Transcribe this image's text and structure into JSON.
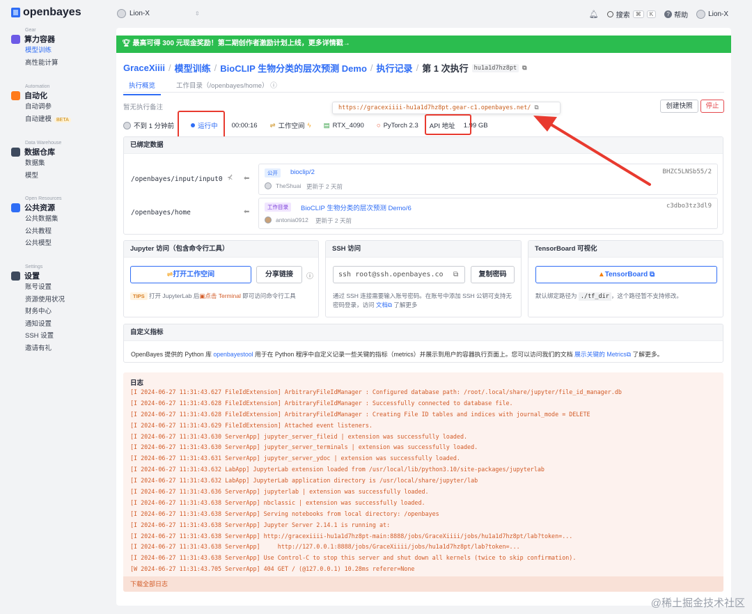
{
  "brand": "openbayes",
  "sidebar": [
    {
      "eng": "Gear",
      "title": "算力容器",
      "color": "#6d5ae6",
      "items": [
        {
          "label": "模型训练",
          "active": true
        },
        {
          "label": "高性能计算"
        }
      ]
    },
    {
      "eng": "Automation",
      "title": "自动化",
      "color": "#ff7a1a",
      "items": [
        {
          "label": "自动调参"
        },
        {
          "label": "自动建模",
          "badge": "BETA"
        }
      ]
    },
    {
      "eng": "Data Warehouse",
      "title": "数据仓库",
      "color": "#3e4a5e",
      "items": [
        {
          "label": "数据集"
        },
        {
          "label": "模型"
        }
      ]
    },
    {
      "eng": "Open Resources",
      "title": "公共资源",
      "color": "#2f6df5",
      "items": [
        {
          "label": "公共数据集"
        },
        {
          "label": "公共教程"
        },
        {
          "label": "公共模型"
        }
      ]
    },
    {
      "eng": "Settings",
      "title": "设置",
      "color": "#3e4a5e",
      "items": [
        {
          "label": "账号设置"
        },
        {
          "label": "资源使用状况"
        },
        {
          "label": "财务中心"
        },
        {
          "label": "通知设置"
        },
        {
          "label": "SSH 设置"
        },
        {
          "label": "邀请有礼"
        }
      ]
    }
  ],
  "topbar": {
    "workspace": "Lion-X",
    "search": "搜索",
    "kbd1": "⌘",
    "kbd2": "K",
    "help": "帮助",
    "user": "Lion-X"
  },
  "banner": "最高可得 300 元现金奖励！第二期创作者激励计划上线，更多详情戳→",
  "breadcrumb": {
    "c1": "GraceXiiii",
    "c2": "模型训练",
    "c3": "BioCLIP 生物分类的层次预测 Demo",
    "c4": "执行记录",
    "c5": "第 1 次执行",
    "hash": "hu1a1d7hz8pt"
  },
  "tabs": {
    "t1": "执行概览",
    "t2": "工作目录（/openbayes/home）"
  },
  "note": "暂无执行备注",
  "buttons": {
    "snapshot": "创建快照",
    "stop": "停止"
  },
  "tooltip": "https://gracexiiii-hu1a1d7hz8pt.gear-c1.openbayes.net/",
  "status": {
    "time": "不到 1 分钟前",
    "state": "运行中",
    "duration": "00:00:16",
    "workspace": "工作空间",
    "gpu": "RTX_4090",
    "framework": "PyTorch 2.3",
    "api": "API 地址",
    "size": "1.99 GB"
  },
  "bound": {
    "title": "已绑定数据",
    "row1": {
      "path": "/openbayes/input/input0",
      "tag": "公开",
      "name": "bioclip/2",
      "user": "TheShuai",
      "updated": "更新于 2 天前",
      "hash": "BHZC5LNSb55/2"
    },
    "row2": {
      "path": "/openbayes/home",
      "tag": "工作目录",
      "name": "BioCLIP 生物分类的层次预测 Demo/6",
      "user": "antonia0912",
      "updated": "更新于 2 天前",
      "hash": "c3dbo3tz3dl9"
    }
  },
  "jupyter": {
    "title": "Jupyter 访问（包含命令行工具）",
    "open": "打开工作空间",
    "share": "分享链接",
    "tips": "TIPS",
    "tip_a": "打开 JupyterLab 后",
    "tip_b": "点击 Terminal",
    "tip_c": "即可访问命令行工具"
  },
  "ssh": {
    "title": "SSH 访问",
    "cmd": "ssh root@ssh.openbayes.co",
    "copy": "复制密码",
    "desc": "通过 SSH 连接需要输入账号密码。在账号中添加 SSH 公钥可支持无密码登录，访问",
    "doc": "文档",
    "desc2": "了解更多"
  },
  "tensorboard": {
    "title": "TensorBoard 可视化",
    "btn": "TensorBoard",
    "desc_a": "默认绑定路径为",
    "path": "./tf_dir",
    "desc_b": "，这个路径暂不支持修改。"
  },
  "metrics": {
    "title": "自定义指标",
    "a": "OpenBayes 提供的 Python 库",
    "lib": "openbayestool",
    "b": "用于在 Python 程序中自定义记录一些关键的指标（metrics）并展示到用户的容器执行页面上。您可以访问我们的文档",
    "link": "展示关键的 Metrics",
    "c": "了解更多。"
  },
  "log": {
    "title": "日志",
    "footer": "下载全部日志",
    "lines": [
      "[I 2024-06-27 11:31:43.627 FileIdExtension] ArbitraryFileIdManager : Configured database path: /root/.local/share/jupyter/file_id_manager.db",
      "[I 2024-06-27 11:31:43.628 FileIdExtension] ArbitraryFileIdManager : Successfully connected to database file.",
      "[I 2024-06-27 11:31:43.628 FileIdExtension] ArbitraryFileIdManager : Creating File ID tables and indices with journal_mode = DELETE",
      "[I 2024-06-27 11:31:43.629 FileIdExtension] Attached event listeners.",
      "[I 2024-06-27 11:31:43.630 ServerApp] jupyter_server_fileid | extension was successfully loaded.",
      "[I 2024-06-27 11:31:43.630 ServerApp] jupyter_server_terminals | extension was successfully loaded.",
      "[I 2024-06-27 11:31:43.631 ServerApp] jupyter_server_ydoc | extension was successfully loaded.",
      "[I 2024-06-27 11:31:43.632 LabApp] JupyterLab extension loaded from /usr/local/lib/python3.10/site-packages/jupyterlab",
      "[I 2024-06-27 11:31:43.632 LabApp] JupyterLab application directory is /usr/local/share/jupyter/lab",
      "[I 2024-06-27 11:31:43.636 ServerApp] jupyterlab | extension was successfully loaded.",
      "[I 2024-06-27 11:31:43.638 ServerApp] nbclassic | extension was successfully loaded.",
      "[I 2024-06-27 11:31:43.638 ServerApp] Serving notebooks from local directory: /openbayes",
      "[I 2024-06-27 11:31:43.638 ServerApp] Jupyter Server 2.14.1 is running at:",
      "[I 2024-06-27 11:31:43.638 ServerApp] http://gracexiiii-hu1a1d7hz8pt-main:8888/jobs/GraceXiiii/jobs/hu1a1d7hz8pt/lab?token=...",
      "[I 2024-06-27 11:31:43.638 ServerApp]     http://127.0.0.1:8888/jobs/GraceXiiii/jobs/hu1a1d7hz8pt/lab?token=...",
      "[I 2024-06-27 11:31:43.638 ServerApp] Use Control-C to stop this server and shut down all kernels (twice to skip confirmation).",
      "[W 2024-06-27 11:31:43.705 ServerApp] 404 GET / (@127.0.0.1) 10.28ms referer=None"
    ]
  },
  "watermark": "@稀土掘金技术社区"
}
